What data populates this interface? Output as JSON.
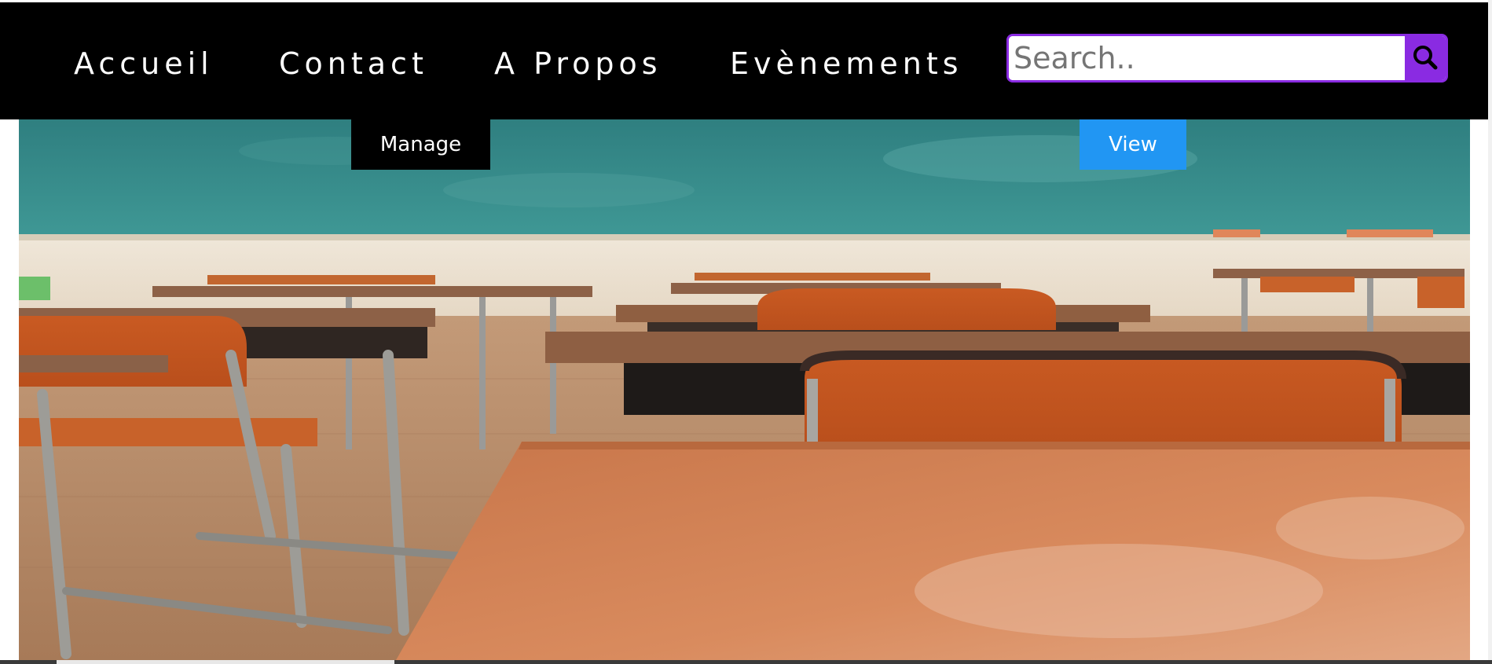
{
  "nav": {
    "links": [
      {
        "label": "Accueil"
      },
      {
        "label": "Contact"
      },
      {
        "label": "A Propos"
      },
      {
        "label": "Evènements"
      }
    ]
  },
  "search": {
    "placeholder": "Search..",
    "value": "",
    "button_icon": "search-icon"
  },
  "actions": {
    "manage_label": "Manage",
    "view_label": "View"
  },
  "hero": {
    "image": "classroom-photo"
  },
  "colors": {
    "topbar": "#000000",
    "search_accent": "#8a2be2",
    "view_button": "#2196f3",
    "manage_button": "#000000"
  }
}
